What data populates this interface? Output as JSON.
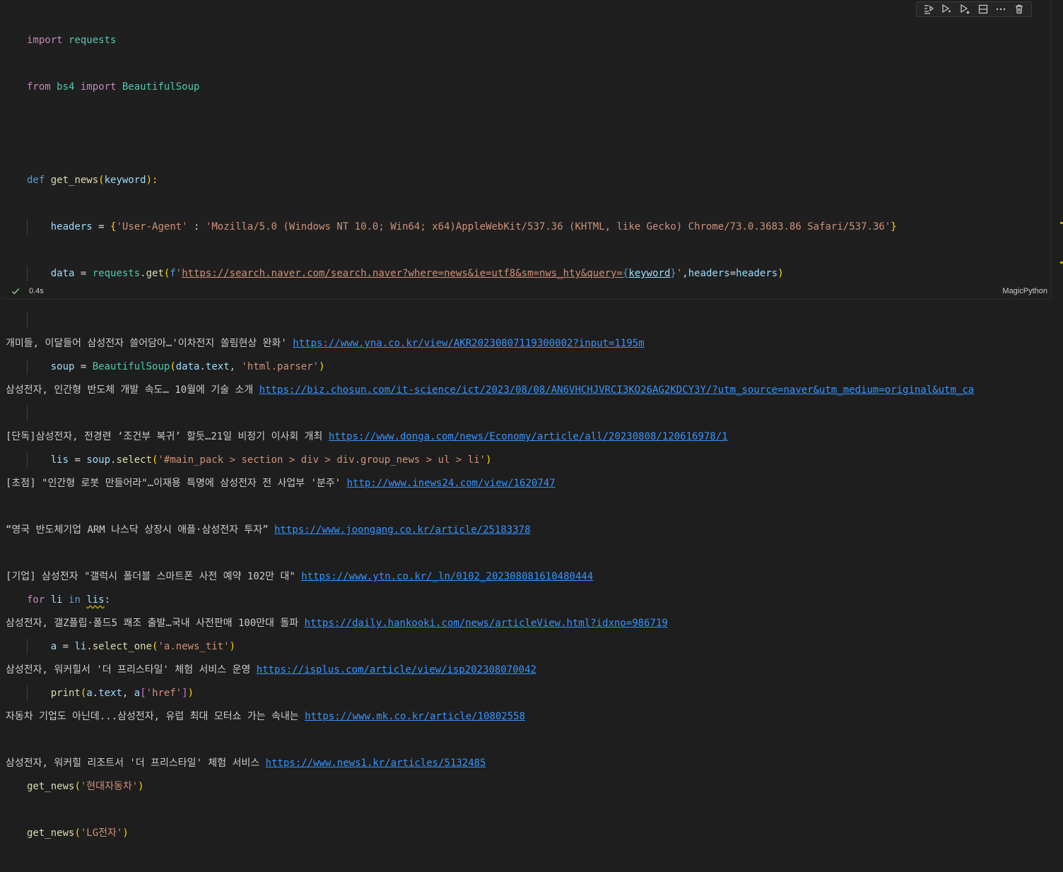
{
  "code": {
    "l1": {
      "kw": "import",
      "mod": " requests"
    },
    "l2": {
      "kw1": "from",
      "mod": " bs4 ",
      "kw2": "import",
      "cls": " BeautifulSoup"
    },
    "l4": {
      "def": "def",
      "fn": " get_news",
      "p1": "(",
      "arg": "keyword",
      "p2": "):"
    },
    "l5": {
      "var": "headers",
      "eq": " = ",
      "b1": "{",
      "k": "'User-Agent'",
      "colon": " : ",
      "v": "'Mozilla/5.0 (Windows NT 10.0; Win64; x64)AppleWebKit/537.36 (KHTML, like Gecko) Chrome/73.0.3683.86 Safari/537.36'",
      "b2": "}"
    },
    "l6": {
      "var": "data",
      "eq": " = ",
      "mod": "requests",
      "dot": ".",
      "fn": "get",
      "p1": "(",
      "pre": "f'",
      "url": "https://search.naver.com/search.naver?where=news&ie=utf8&sm=nws_hty&query=",
      "b1": "{",
      "arg": "keyword",
      "b2": "}",
      "q": "'",
      "comma": ",",
      "kwarg": "headers",
      "eq2": "=",
      "val": "headers",
      "p2": ")"
    },
    "l8": {
      "var": "soup",
      "eq": " = ",
      "cls": "BeautifulSoup",
      "p1": "(",
      "a1": "data",
      "dot": ".",
      "a2": "text",
      "comma": ", ",
      "str": "'html.parser'",
      "p2": ")"
    },
    "l10": {
      "var": "lis",
      "eq": " = ",
      "obj": "soup",
      "dot": ".",
      "fn": "select",
      "p1": "(",
      "str": "'#main_pack > section > div > div.group_news > ul > li'",
      "p2": ")"
    },
    "l13": {
      "kw1": "for",
      "v1": " li ",
      "kw2": "in",
      "v2": "lis",
      "colon": ":"
    },
    "l14": {
      "var": "a",
      "eq": " = ",
      "obj": "li",
      "dot": ".",
      "fn": "select_one",
      "p1": "(",
      "str": "'a.news_tit'",
      "p2": ")"
    },
    "l15": {
      "fn": "print",
      "p1": "(",
      "a1": "a",
      "dot": ".",
      "a2": "text",
      "comma": ", ",
      "a3": "a",
      "b1": "[",
      "str": "'href'",
      "b2": "]",
      "p2": ")"
    },
    "l17": {
      "fn": "get_news",
      "p1": "(",
      "str": "'현대자동차'",
      "p2": ")"
    },
    "l18": {
      "fn": "get_news",
      "p1": "(",
      "str": "'LG전자'",
      "p2": ")"
    }
  },
  "status": {
    "exec_time": "0.4s",
    "language": "MagicPython"
  },
  "output": [
    {
      "text": "개미들, 이달들어 삼성전자 쓸어담아…'이차전지 쏠림현상 완화' ",
      "url": "https://www.yna.co.kr/view/AKR20230807119300002?input=1195m"
    },
    {
      "text": "삼성전자, 인간형 반도체 개발 속도… 10월에 기술 소개 ",
      "url": "https://biz.chosun.com/it-science/ict/2023/08/08/AN6VHCHJVRCI3KO26AG2KDCY3Y/?utm_source=naver&utm_medium=original&utm_ca"
    },
    {
      "text": "[단독]삼성전자, 전경련 ‘조건부 복귀’ 할듯…21일 비정기 이사회 개최 ",
      "url": "https://www.donga.com/news/Economy/article/all/20230808/120616978/1"
    },
    {
      "text": "[초점] \"인간형 로봇 만들어라\"…이재용 특명에 삼성전자 전 사업부 '분주' ",
      "url": "http://www.inews24.com/view/1620747"
    },
    {
      "text": "“영국 반도체기업 ARM 나스닥 상장시 애플·삼성전자 투자” ",
      "url": "https://www.joongang.co.kr/article/25183378"
    },
    {
      "text": "[기업] 삼성전자 \"갤럭시 폴더블 스마트폰 사전 예약 102만 대\" ",
      "url": "https://www.ytn.co.kr/_ln/0102_202308081610480444"
    },
    {
      "text": "삼성전자, 갤Z플립·폴드5 쾌조 출발…국내 사전판매 100만대 돌파 ",
      "url": "https://daily.hankooki.com/news/articleView.html?idxno=986719"
    },
    {
      "text": "삼성전자, 워커힐서 '더 프리스타일' 체험 서비스 운영 ",
      "url": "https://isplus.com/article/view/isp202308070042"
    },
    {
      "text": "자동차 기업도 아닌데...삼성전자, 유럽 최대 모터쇼 가는 속내는 ",
      "url": "https://www.mk.co.kr/article/10802558"
    },
    {
      "text": "삼성전자, 워커힐 리조트서 '더 프리스타일' 체험 서비스 ",
      "url": "https://www.news1.kr/articles/5132485"
    }
  ]
}
